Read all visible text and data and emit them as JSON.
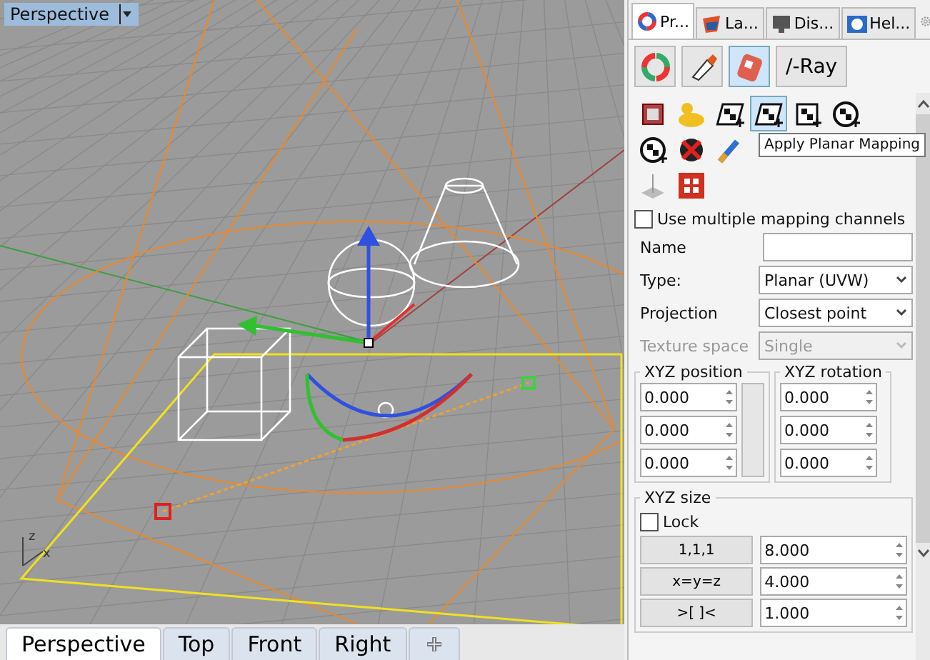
{
  "viewport": {
    "title": "Perspective",
    "axis_labels": [
      "z",
      "x"
    ],
    "tabs": [
      {
        "label": "Perspective",
        "selected": true
      },
      {
        "label": "Top",
        "selected": false
      },
      {
        "label": "Front",
        "selected": false
      },
      {
        "label": "Right",
        "selected": false
      }
    ]
  },
  "panel": {
    "tabs": [
      {
        "label": "Pr...",
        "kind": "wheel",
        "selected": true
      },
      {
        "label": "La...",
        "kind": "layers",
        "selected": false
      },
      {
        "label": "Dis...",
        "kind": "display",
        "selected": false
      },
      {
        "label": "Hel...",
        "kind": "help",
        "selected": false
      }
    ],
    "toolbar": [
      {
        "kind": "wheel",
        "selected": false
      },
      {
        "kind": "tube",
        "selected": false
      },
      {
        "kind": "decal",
        "selected": true
      },
      {
        "kind": "text",
        "label": "/-Ray",
        "selected": false
      }
    ],
    "mapping_tools": [
      [
        {
          "kind": "box",
          "selected": false
        },
        {
          "kind": "duck",
          "selected": false
        },
        {
          "kind": "checker",
          "selected": false
        },
        {
          "kind": "planar",
          "selected": true
        },
        {
          "kind": "cube",
          "selected": false
        },
        {
          "kind": "sphere",
          "selected": false
        }
      ],
      [
        {
          "kind": "cylinder",
          "selected": false
        },
        {
          "kind": "remove",
          "selected": false
        },
        {
          "kind": "brush",
          "selected": false
        }
      ],
      [
        {
          "kind": "gumball",
          "selected": false
        },
        {
          "kind": "grid",
          "selected": false
        }
      ]
    ],
    "tooltip": "Apply Planar Mapping",
    "multi_channel": {
      "label": "Use multiple mapping channels",
      "checked": false
    },
    "fields": [
      {
        "label": "Name",
        "kind": "text"
      },
      {
        "label": "Type:",
        "kind": "select",
        "value": "Planar (UVW)",
        "disabled": false
      },
      {
        "label": "Projection",
        "kind": "select",
        "value": "Closest point",
        "disabled": false
      },
      {
        "label": "Texture space",
        "kind": "select",
        "value": "Single",
        "disabled": true
      }
    ],
    "position": {
      "title": "XYZ position",
      "values": [
        "0.000",
        "0.000",
        "0.000"
      ]
    },
    "rotation": {
      "title": "XYZ rotation",
      "values": [
        "0.000",
        "0.000",
        "0.000"
      ]
    },
    "size": {
      "title": "XYZ size",
      "lock": {
        "label": "Lock",
        "checked": false
      },
      "buttons": [
        "1,1,1",
        "x=y=z",
        ">[ ]<"
      ],
      "values": [
        "8.000",
        "4.000",
        "1.000"
      ]
    }
  }
}
